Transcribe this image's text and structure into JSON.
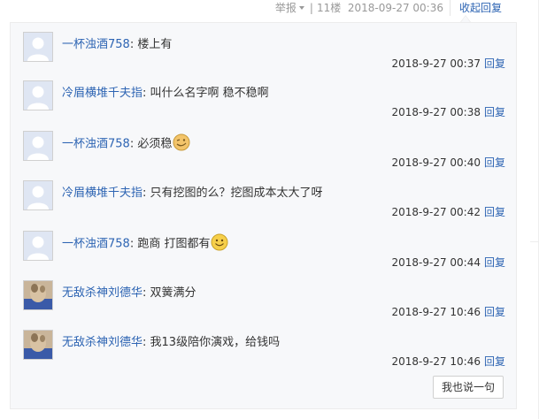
{
  "topbar": {
    "report_label": "举报",
    "floor": "11楼",
    "timestamp": "2018-09-27 00:36",
    "collapse_label": "收起回复"
  },
  "replies": [
    {
      "user": "一杯浊酒758",
      "text": "楼上有",
      "emoticon": "",
      "time": "2018-9-27 00:37",
      "reply_label": "回复",
      "avatar": "default-avatar"
    },
    {
      "user": "冷眉横堆千夫指",
      "text": "叫什么名字啊 稳不稳啊",
      "emoticon": "",
      "time": "2018-9-27 00:38",
      "reply_label": "回复",
      "avatar": "default-avatar"
    },
    {
      "user": "一杯浊酒758",
      "text": "必须稳",
      "emoticon": "wink-face-icon",
      "time": "2018-9-27 00:40",
      "reply_label": "回复",
      "avatar": "default-avatar"
    },
    {
      "user": "冷眉横堆千夫指",
      "text": "只有挖图的么？挖图成本太大了呀",
      "emoticon": "",
      "time": "2018-9-27 00:42",
      "reply_label": "回复",
      "avatar": "default-avatar"
    },
    {
      "user": "一杯浊酒758",
      "text": "跑商 打图都有",
      "emoticon": "smile-face-icon",
      "time": "2018-9-27 00:44",
      "reply_label": "回复",
      "avatar": "default-avatar"
    },
    {
      "user": "无敌杀神刘德华",
      "text": "双簧满分",
      "emoticon": "",
      "time": "2018-9-27 10:46",
      "reply_label": "回复",
      "avatar": "photo-avatar"
    },
    {
      "user": "无敌杀神刘德华",
      "text": "我13级陪你演戏，给钱吗",
      "emoticon": "",
      "time": "2018-9-27 10:46",
      "reply_label": "回复",
      "avatar": "photo-avatar"
    }
  ],
  "say_button_label": "我也说一句",
  "colors": {
    "link": "#2d64b3",
    "panel_bg": "#f7f8fa",
    "text": "#333333",
    "meta": "#999999"
  }
}
